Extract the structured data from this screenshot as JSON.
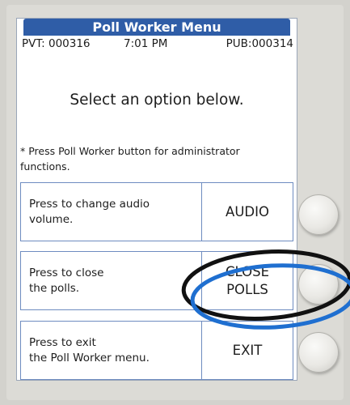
{
  "header": {
    "title": "Poll Worker Menu",
    "pvt": "PVT: 000316",
    "time": "7:01 PM",
    "pub": "PUB:000314"
  },
  "prompt": "Select an option below.",
  "note": "* Press Poll Worker button for administrator functions.",
  "options": [
    {
      "description": "Press to change audio\nvolume.",
      "action": "AUDIO"
    },
    {
      "description": "Press to close\nthe polls.",
      "action": "CLOSE\nPOLLS"
    },
    {
      "description": "Press to exit\nthe Poll Worker menu.",
      "action": "EXIT"
    }
  ],
  "colors": {
    "title_bar": "#2f5da7",
    "row_border": "#6e8cc0",
    "highlight_black": "#111111",
    "highlight_blue": "#1f6fd0"
  },
  "annotations": {
    "highlighted_option": "CLOSE POLLS"
  }
}
